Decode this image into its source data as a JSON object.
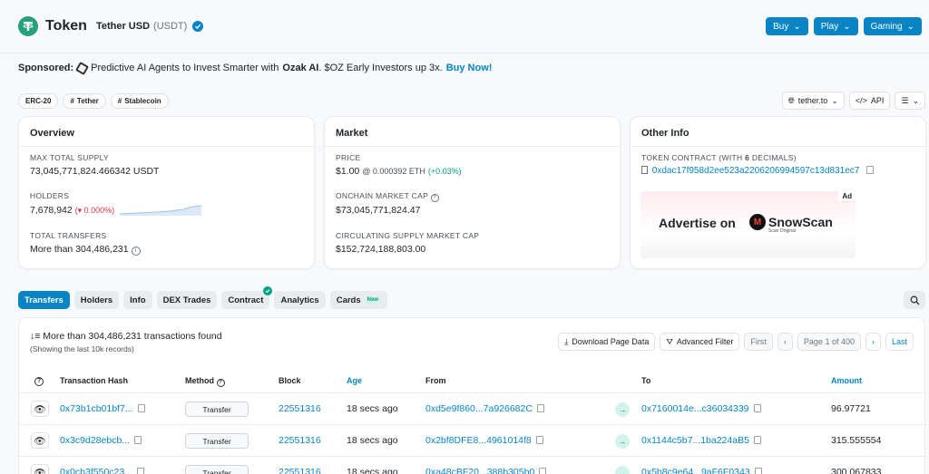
{
  "header": {
    "label": "Token",
    "token_name": "Tether USD",
    "token_symbol": "(USDT)",
    "buttons": [
      "Buy",
      "Play",
      "Gaming"
    ]
  },
  "sponsored": {
    "label": "Sponsored:",
    "text": "Predictive AI Agents to Invest Smarter with",
    "brand": "Ozak AI",
    "tail": ". $OZ Early Investors up 3x.",
    "cta": "Buy Now!"
  },
  "tags": [
    "ERC-20",
    "Tether",
    "Stablecoin"
  ],
  "controls": {
    "site": "tether.to",
    "api": "API"
  },
  "overview": {
    "title": "Overview",
    "max_supply_label": "MAX TOTAL SUPPLY",
    "max_supply": "73,045,771,824.466342 USDT",
    "holders_label": "HOLDERS",
    "holders": "7,678,942",
    "holders_change": "(▾ 0.000%)",
    "transfers_label": "TOTAL TRANSFERS",
    "transfers": "More than 304,486,231"
  },
  "market": {
    "title": "Market",
    "price_label": "PRICE",
    "price": "$1.00",
    "price_eth": "@ 0.000392 ETH",
    "price_change": "(+0.03%)",
    "mcap_label": "ONCHAIN MARKET CAP",
    "mcap": "$73,045,771,824.47",
    "circ_label": "CIRCULATING SUPPLY MARKET CAP",
    "circ": "$152,724,188,803.00"
  },
  "other": {
    "title": "Other Info",
    "contract_label_pre": "TOKEN CONTRACT (WITH",
    "contract_decimals": "6",
    "contract_label_post": "DECIMALS)",
    "contract": "0xdac17f958d2ee523a2206206994597c13d831ec7",
    "ad_tag": "Ad",
    "ad_text": "Advertise on",
    "ad_brand": "SnowScan",
    "ad_sub": "Scan Original"
  },
  "tabs": [
    {
      "label": "Transfers"
    },
    {
      "label": "Holders"
    },
    {
      "label": "Info"
    },
    {
      "label": "DEX Trades"
    },
    {
      "label": "Contract"
    },
    {
      "label": "Analytics"
    },
    {
      "label": "Cards",
      "badge": "New"
    }
  ],
  "table": {
    "found": "More than 304,486,231 transactions found",
    "showing": "(Showing the last 10k records)",
    "download": "Download Page Data",
    "filter": "Advanced Filter",
    "first": "First",
    "page": "Page 1 of 400",
    "last": "Last",
    "headers": {
      "hash": "Transaction Hash",
      "method": "Method",
      "block": "Block",
      "age": "Age",
      "from": "From",
      "to": "To",
      "amount": "Amount"
    },
    "rows": [
      {
        "hash": "0x73b1cb01bf7...",
        "method": "Transfer",
        "block": "22551316",
        "age": "18 secs ago",
        "from": "0xd5e9f860...7a926682C",
        "to": "0x7160014e...c36034339",
        "amount": "96.97721"
      },
      {
        "hash": "0x3c9d28ebcb...",
        "method": "Transfer",
        "block": "22551316",
        "age": "18 secs ago",
        "from": "0x2bf8DFE8...4961014f8",
        "to": "0x1144c5b7...1ba224aB5",
        "amount": "315.555554"
      },
      {
        "hash": "0x0cb3f550c23...",
        "method": "Transfer",
        "block": "22551316",
        "age": "18 secs ago",
        "from": "0xa48cBF20...388b305b0",
        "to": "0x5b8c9e64...9aF6F0343",
        "amount": "300.067833"
      }
    ]
  },
  "colors": {
    "accent": "#0784c3",
    "tether": "#26a17b",
    "green": "#00a186",
    "red": "#dc3545"
  }
}
